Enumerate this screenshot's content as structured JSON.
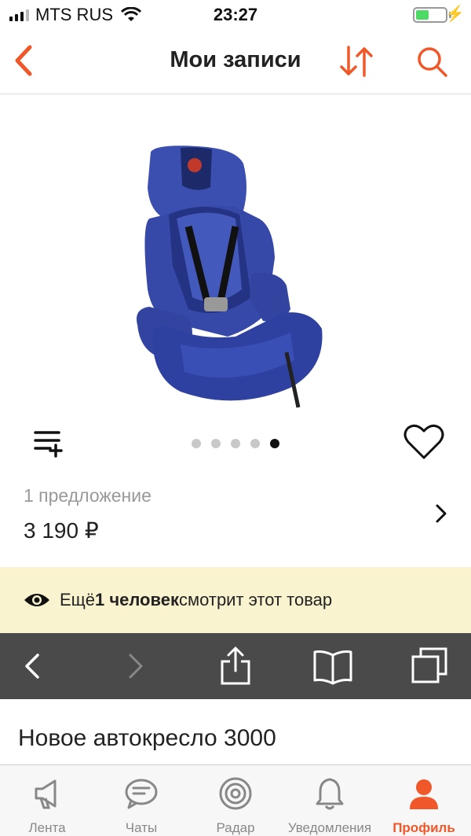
{
  "status_bar": {
    "carrier": "MTS RUS",
    "time": "23:27",
    "battery_level": 0.45
  },
  "nav": {
    "title": "Мои записи",
    "accent_color": "#f0582a"
  },
  "gallery": {
    "image_count": 5,
    "active_index": 4
  },
  "offers": {
    "count_label": "1 предложение",
    "price": "3 190 ₽"
  },
  "viewers_banner": {
    "prefix": "Ещё ",
    "bold": "1 человек",
    "suffix": " смотрит этот товар",
    "background": "#faf3cf"
  },
  "product": {
    "title": "Новое автокресло 3000"
  },
  "tab_bar": {
    "tabs": [
      {
        "label": "Лента",
        "icon": "megaphone-icon"
      },
      {
        "label": "Чаты",
        "icon": "chat-bubble-icon"
      },
      {
        "label": "Радар",
        "icon": "radar-icon"
      },
      {
        "label": "Уведомления",
        "icon": "bell-icon"
      },
      {
        "label": "Профиль",
        "icon": "profile-icon",
        "active": true
      }
    ]
  }
}
